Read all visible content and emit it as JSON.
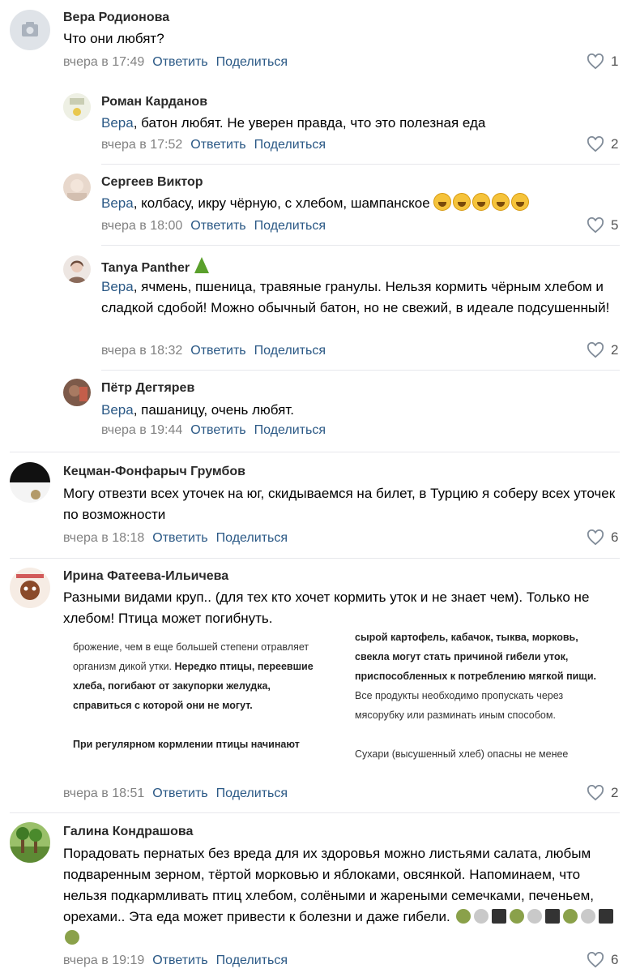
{
  "comments": [
    {
      "author": "Вера Родионова",
      "text": "Что они любят?",
      "time": "вчера в 17:49",
      "reply": "Ответить",
      "share": "Поделиться",
      "likes": "1"
    },
    {
      "author": "Роман Карданов",
      "reply_to": "Вера",
      "text": ", батон любят. Не уверен правда, что это полезная еда",
      "time": "вчера в 17:52",
      "reply": "Ответить",
      "share": "Поделиться",
      "likes": "2"
    },
    {
      "author": "Сергеев Виктор",
      "reply_to": "Вера",
      "text": ", колбасу, икру чёрную, с хлебом, шампанское",
      "time": "вчера в 18:00",
      "reply": "Ответить",
      "share": "Поделиться",
      "likes": "5"
    },
    {
      "author": "Tanya Panther",
      "reply_to": "Вера",
      "text": ", ячмень, пшеница, травяные гранулы. Нельзя кормить чёрным хлебом и сладкой сдобой! Можно обычный батон, но не свежий, в идеале подсушенный!",
      "time": "вчера в 18:32",
      "reply": "Ответить",
      "share": "Поделиться",
      "likes": "2"
    },
    {
      "author": "Пётр Дегтярев",
      "reply_to": "Вера",
      "text": ", пашаницу, очень любят.",
      "time": "вчера в 19:44",
      "reply": "Ответить",
      "share": "Поделиться"
    },
    {
      "author": "Кецман-Фонфарыч Грумбов",
      "text": "Могу отвезти всех уточек на юг, скидываемся на билет, в Турцию я соберу всех уточек по возможности",
      "time": "вчера в 18:18",
      "reply": "Ответить",
      "share": "Поделиться",
      "likes": "6"
    },
    {
      "author": "Ирина Фатеева-Ильичева",
      "text": "Разными видами круп.. (для тех кто хочет кормить уток и не знает чем). Только не хлебом! Птица может погибнуть.",
      "time": "вчера в 18:51",
      "reply": "Ответить",
      "share": "Поделиться",
      "likes": "2"
    },
    {
      "author": "Галина Кондрашова",
      "text": "Порадовать пернатых без вреда для их здоровья можно листьями салата, любым подваренным зерном, тёртой морковью и яблоками, овсянкой. Напоминаем, что нельзя подкармливать птиц хлебом, солёными и жареными семечками, печеньем, орехами.. Эта еда может привести к болезни и даже гибели.",
      "time": "вчера в 19:19",
      "reply": "Ответить",
      "share": "Поделиться",
      "likes": "6"
    }
  ],
  "attachment": {
    "left_p1": "брожение, чем в еще большей степени отравляет организм дикой утки. ",
    "left_p1_bold": "Нередко птицы, переевшие хлеба, погибают от закупорки желудка, справиться с которой они не могут.",
    "left_p2_bold": "При регулярном кормлении птицы начинают",
    "right_p1_bold": "сырой картофель, кабачок, тыква, морковь, свекла могут стать причиной гибели уток, приспособленных к потреблению мягкой пищи.",
    "right_p1": " Все продукты необходимо пропускать через мясорубку или разминать иным способом.",
    "right_p2": "Сухари (высушенный хлеб) опасны не менее"
  },
  "colors": {
    "link": "#2a5885",
    "meta": "#828282",
    "separator": "#e7e8ec"
  }
}
